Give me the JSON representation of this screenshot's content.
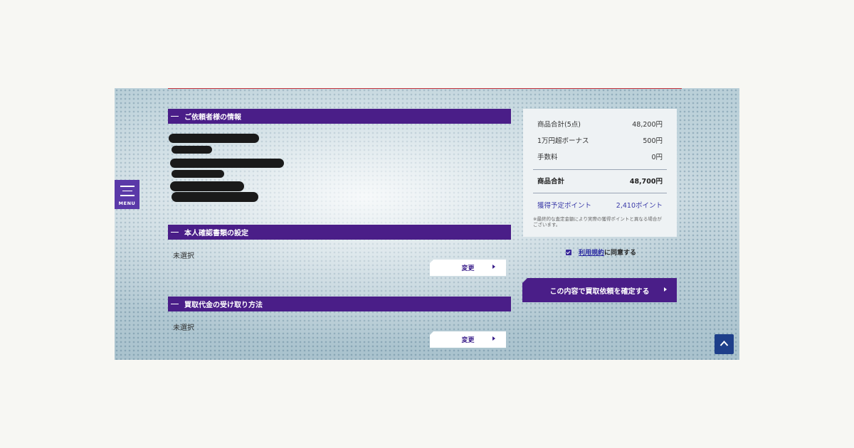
{
  "menu": {
    "label": "MENU"
  },
  "sections": {
    "requester": {
      "title": "ご依頼者様の情報"
    },
    "identity": {
      "title": "本人確認書類の設定",
      "value": "未選択",
      "change_label": "変更"
    },
    "payment": {
      "title": "買取代金の受け取り方法",
      "value": "未選択",
      "change_label": "変更"
    }
  },
  "summary": {
    "rows": [
      {
        "label": "商品合計(5点)",
        "value": "48,200円"
      },
      {
        "label": "1万円超ボーナス",
        "value": "500円"
      },
      {
        "label": "手数料",
        "value": "0円"
      }
    ],
    "total": {
      "label": "商品合計",
      "value": "48,700円"
    },
    "points": {
      "label": "獲得予定ポイント",
      "value": "2,410ポイント"
    },
    "note": "※最終的な査定金額により実際の獲得ポイントと異なる場合がございます。"
  },
  "agreement": {
    "link_text": "利用規約",
    "suffix": "に同意する",
    "checked": true
  },
  "confirm": {
    "label": "この内容で買取依頼を確定する"
  },
  "colors": {
    "section_bar": "#4a1e88",
    "menu": "#5a39a8",
    "top_button": "#1e3f8a"
  },
  "icons": {
    "menu": "hamburger-icon",
    "top": "chevron-up-icon",
    "arrow": "caret-right-icon"
  }
}
